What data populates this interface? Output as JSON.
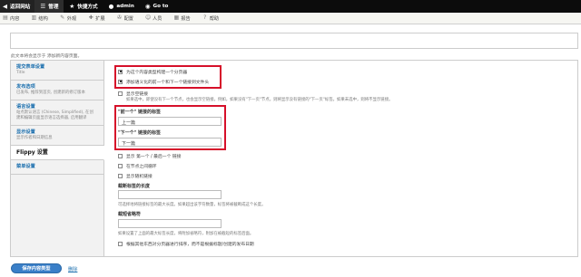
{
  "topbar": {
    "home_label": "返回网站",
    "manage_label": "管理",
    "shortcuts_label": "快捷方式",
    "user_label": "admin",
    "goto_label": "Go to"
  },
  "subbar": {
    "items": [
      "内容",
      "结构",
      "外观",
      "扩展",
      "配置",
      "人员",
      "报告",
      "帮助"
    ]
  },
  "body_field": {
    "hint": "此文本将会显示于 添加新内容页面。"
  },
  "vtabs": [
    {
      "title": "提交表单设置",
      "summary": "Title"
    },
    {
      "title": "发布选项",
      "summary": "已发布, 推荐到首页, 创建新的修订版本"
    },
    {
      "title": "语言设置",
      "summary": "站点默认语言 (Chinese, Simplified), 在创建和编辑页面显示语言选择器, 启用翻译"
    },
    {
      "title": "显示设置",
      "summary": "显示作者和日期信息"
    },
    {
      "title": "Flippy 设置",
      "summary": ""
    },
    {
      "title": "菜单设置",
      "summary": ""
    }
  ],
  "flippy": {
    "cb1_label": "为这个内容类型构建一个分页器",
    "cb2_label": "添加语义化的前一个和下一个链接到文件头",
    "cb3_label": "显示空链接",
    "cb3_desc": "如果选中，即使没有下一个节点，也会显示空链接。例如，如果没有\"下一页\"节点，则将显示没有链接的\"下一页\"标签。如果未选中，则将不显示链接。",
    "first_label": "\"前一个\" 链接的标签",
    "first_value": "上一篇",
    "next_label": "\"下一个\" 链接的标签",
    "next_value": "下一篇",
    "cb4_label": "显示 第一个 / 最后一个 链接",
    "cb5_label": "在节点之间循环",
    "cb6_label": "显示随机链接",
    "truncate_label": "截断标签的长度",
    "truncate_desc": "可选择地将链接标签的最大长度。如果超出该字符数量，标签将被截断成这个长度。",
    "ellipsis_label": "截短省略符",
    "ellipsis_desc": "如果设置了上面的最大标签长度，将附加省略符，附加在被截短的标签后面。",
    "cb7_label": "根据其他东西对分页器进行排序，而不是根据标题/创建的发布日期"
  },
  "actions": {
    "save_label": "保存内容类型",
    "delete_label": "删除"
  }
}
